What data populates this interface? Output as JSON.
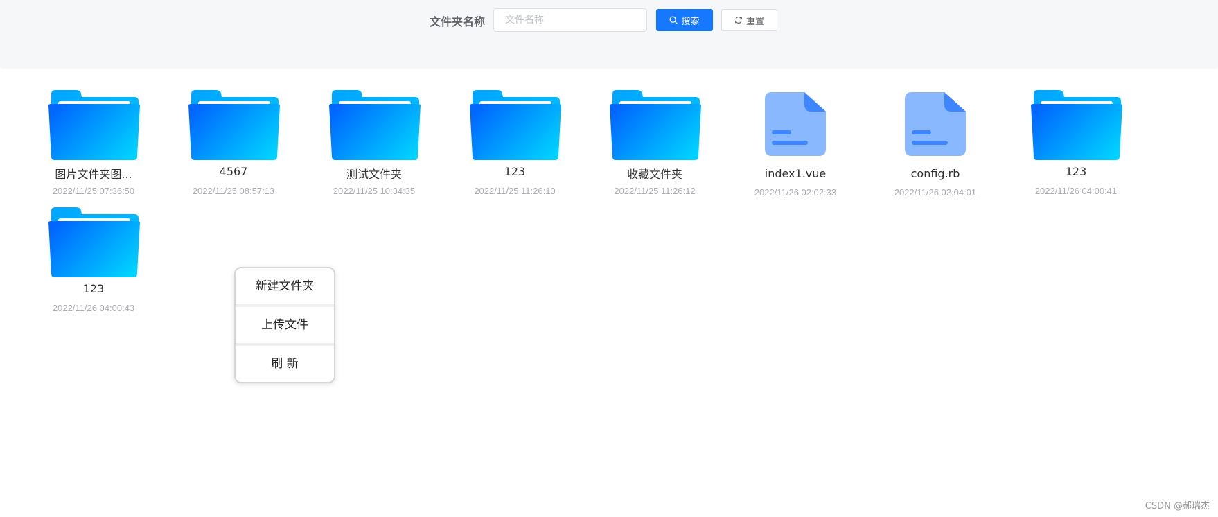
{
  "search": {
    "label": "文件夹名称",
    "placeholder": "文件名称",
    "value": "",
    "search_button": "搜索",
    "reset_button": "重置"
  },
  "items": [
    {
      "type": "folder",
      "name": "图片文件夹图...",
      "date": "2022/11/25 07:36:50"
    },
    {
      "type": "folder",
      "name": "4567",
      "date": "2022/11/25 08:57:13"
    },
    {
      "type": "folder",
      "name": "测试文件夹",
      "date": "2022/11/25 10:34:35"
    },
    {
      "type": "folder",
      "name": "123",
      "date": "2022/11/25 11:26:10"
    },
    {
      "type": "folder",
      "name": "收藏文件夹",
      "date": "2022/11/25 11:26:12"
    },
    {
      "type": "file",
      "name": "index1.vue",
      "date": "2022/11/26 02:02:33"
    },
    {
      "type": "file",
      "name": "config.rb",
      "date": "2022/11/26 02:04:01"
    },
    {
      "type": "folder",
      "name": "123",
      "date": "2022/11/26 04:00:41"
    },
    {
      "type": "folder",
      "name": "123",
      "date": "2022/11/26 04:00:43"
    }
  ],
  "context_menu": {
    "new_folder": "新建文件夹",
    "upload_file": "上传文件",
    "refresh": "刷 新"
  },
  "watermark": "CSDN @郝瑞杰",
  "colors": {
    "primary": "#1677ff",
    "folder_light": "#00d2ff",
    "folder_dark": "#0066ff",
    "file": "#8ab8ff"
  },
  "icons": {
    "search_button_icon": "search-icon",
    "reset_button_icon": "refresh-icon",
    "folder_icon": "folder-icon",
    "file_icon": "file-icon"
  }
}
